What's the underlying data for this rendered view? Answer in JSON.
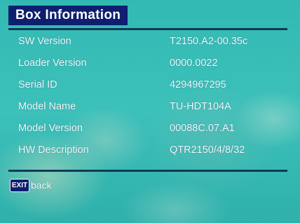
{
  "title": "Box Information",
  "rows": [
    {
      "label": "SW Version",
      "value": "T2150.A2-00.35c"
    },
    {
      "label": "Loader Version",
      "value": "0000.0022"
    },
    {
      "label": "Serial ID",
      "value": "4294967295"
    },
    {
      "label": "Model Name",
      "value": "TU-HDT104A"
    },
    {
      "label": "Model Version",
      "value": "00088C.07.A1"
    },
    {
      "label": "HW Description",
      "value": "QTR2150/4/8/32"
    }
  ],
  "footer": {
    "exit_key": "EXIT",
    "exit_label": "back"
  },
  "colors": {
    "title_bg": "#0e1f6f",
    "rule": "#0f3a56",
    "text": "#f4fbff",
    "background": "#2fb6b0"
  },
  "icons": {
    "exit": "exit-key-icon"
  }
}
